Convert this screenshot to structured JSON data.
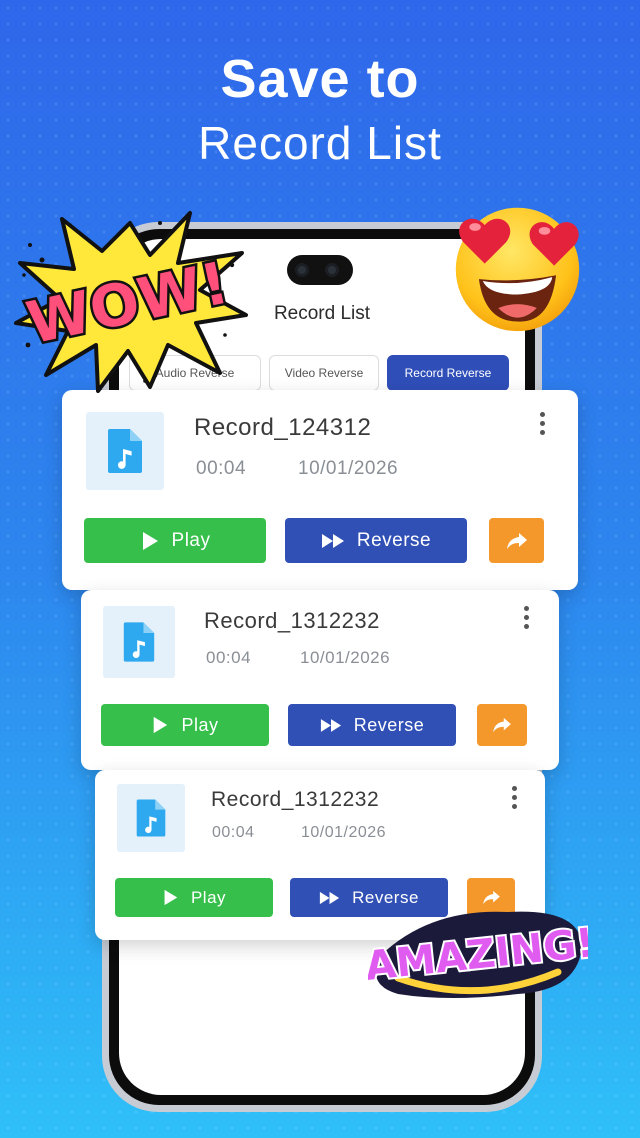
{
  "headline": {
    "line1": "Save to",
    "line2": "Record List"
  },
  "screen": {
    "title": "Record List"
  },
  "tabs": [
    {
      "label": "Audio Reverse",
      "active": false
    },
    {
      "label": "Video Reverse",
      "active": false
    },
    {
      "label": "Record Reverse",
      "active": true
    }
  ],
  "records": [
    {
      "name": "Record_124312",
      "duration": "00:04",
      "date": "10/01/2026",
      "play_label": "Play",
      "reverse_label": "Reverse"
    },
    {
      "name": "Record_1312232",
      "duration": "00:04",
      "date": "10/01/2026",
      "play_label": "Play",
      "reverse_label": "Reverse"
    },
    {
      "name": "Record_1312232",
      "duration": "00:04",
      "date": "10/01/2026",
      "play_label": "Play",
      "reverse_label": "Reverse"
    }
  ],
  "stickers": {
    "wow": "WOW!",
    "amazing": "AMAZING!"
  },
  "icons": {
    "file": "audio-file-icon",
    "play": "play-icon",
    "reverse": "fast-forward-icon",
    "share": "share-arrow-icon",
    "more": "more-vertical-icon"
  },
  "colors": {
    "play": "#36bf4a",
    "reverse": "#3050b5",
    "share": "#f5982b",
    "tab_active": "#2f4eb8"
  }
}
